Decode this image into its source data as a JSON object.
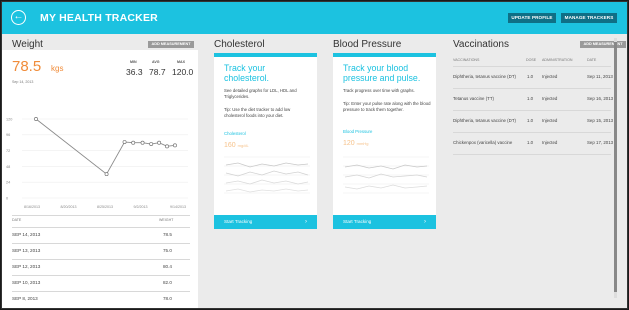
{
  "header": {
    "back_glyph": "←",
    "title": "MY HEALTH TRACKER",
    "update_profile": "UPDATE PROFILE",
    "manage_trackers": "MANAGE TRACKERS"
  },
  "weight": {
    "title": "Weight",
    "add_button": "ADD MEASUREMENT",
    "current_value": "78.5",
    "current_unit": "kgs",
    "current_date": "Sep 14, 2013",
    "stats": [
      {
        "label": "MIN",
        "value": "36.3"
      },
      {
        "label": "AVG",
        "value": "78.7"
      },
      {
        "label": "MAX",
        "value": "120.0"
      }
    ],
    "chart": {
      "y_ticks": [
        "120",
        "96",
        "72",
        "48",
        "24",
        "0"
      ],
      "x_ticks": [
        "8/16/2013",
        "8/20/2013",
        "8/25/2013",
        "9/2/2013",
        "9/14/2013"
      ],
      "points": [
        {
          "x": 0.0,
          "y": 120.0
        },
        {
          "x": 0.49,
          "y": 36.3
        },
        {
          "x": 0.615,
          "y": 85.0
        },
        {
          "x": 0.675,
          "y": 84.0
        },
        {
          "x": 0.74,
          "y": 84.0
        },
        {
          "x": 0.8,
          "y": 82.0
        },
        {
          "x": 0.855,
          "y": 84.0
        },
        {
          "x": 0.91,
          "y": 78.5
        },
        {
          "x": 0.965,
          "y": 80.0
        }
      ]
    },
    "table": {
      "col_date": "DATE",
      "col_weight": "WEIGHT",
      "rows": [
        {
          "date": "SEP 14, 2013",
          "weight": "78.5"
        },
        {
          "date": "SEP 13, 2013",
          "weight": "75.0"
        },
        {
          "date": "SEP 12, 2013",
          "weight": "80.4"
        },
        {
          "date": "SEP 10, 2013",
          "weight": "82.0"
        },
        {
          "date": "SEP 8, 2013",
          "weight": "78.0"
        }
      ]
    }
  },
  "cholesterol": {
    "title": "Cholesterol",
    "headline": "Track your cholesterol.",
    "body": "See detailed graphs for LDL, HDL and Triglycerides.",
    "tip": "Tip: Use the diet tracker to add low cholesterol foods into your diet.",
    "link": "Cholesterol",
    "metric": "160",
    "metric_unit": "mg/dL",
    "cta": "Start Tracking",
    "cta_glyph": "›"
  },
  "blood_pressure": {
    "title": "Blood Pressure",
    "headline": "Track your blood pressure and pulse.",
    "body": "Track progress over time with graphs.",
    "tip": "Tip: Enter your pulse rate along with the blood pressure to track them together.",
    "link": "Blood Pressure",
    "metric": "120",
    "metric_unit": "mmHg",
    "cta": "Start Tracking",
    "cta_glyph": "›"
  },
  "vaccinations": {
    "title": "Vaccinations",
    "add_button": "ADD MEASUREMENT",
    "columns": [
      "VACCINATIONS",
      "DOSE",
      "ADMINISTRATION",
      "DATE"
    ],
    "rows": [
      {
        "name": "Diphtheria, tetanus vaccine (DT)",
        "dose": "1.0",
        "admin": "Injected",
        "date": "Sep 11, 2013"
      },
      {
        "name": "Tetanus vaccine (TT)",
        "dose": "1.0",
        "admin": "Injected",
        "date": "Sep 16, 2013"
      },
      {
        "name": "Diphtheria, tetanus vaccine (DT)",
        "dose": "1.0",
        "admin": "Injected",
        "date": "Sep 15, 2013"
      },
      {
        "name": "Chickenpox (varicella) vaccine",
        "dose": "1.0",
        "admin": "Injected",
        "date": "Sep 17, 2013"
      }
    ]
  },
  "colors": {
    "accent": "#1cc2e0",
    "highlight": "#f08c3a",
    "dark_button": "#0f6f86"
  }
}
